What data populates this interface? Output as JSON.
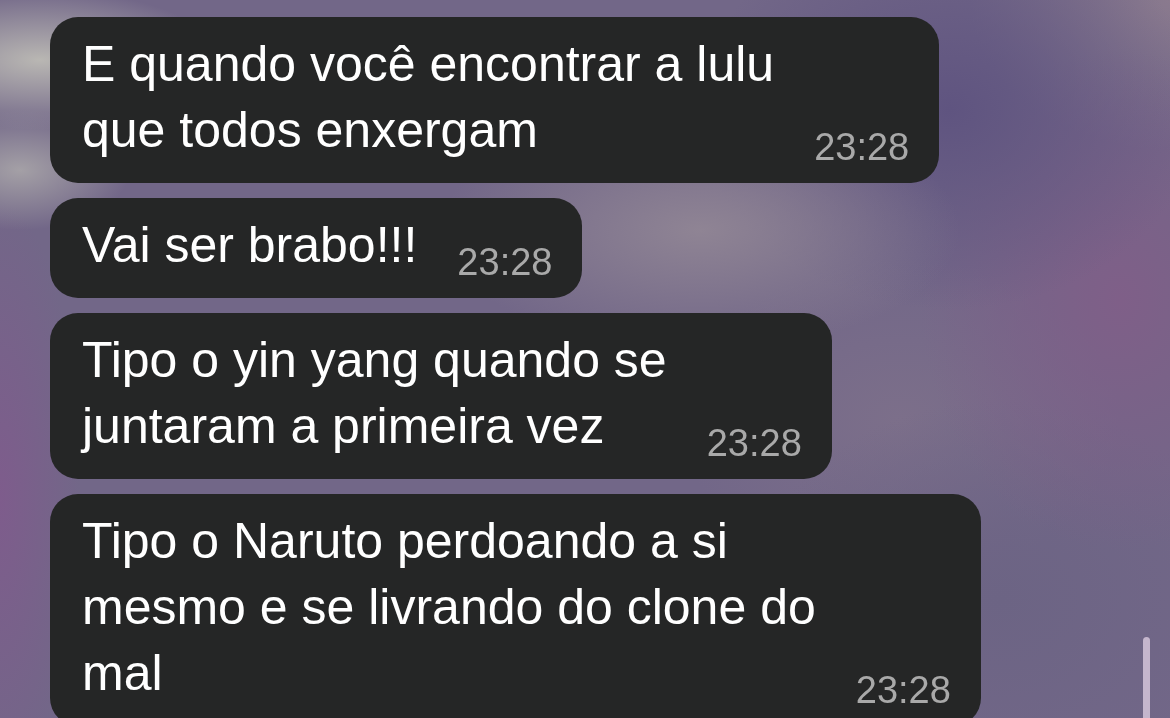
{
  "messages": [
    {
      "text": "E quando você encontrar a lulu\nque todos enxergam",
      "time": "23:28"
    },
    {
      "text": "Vai ser brabo!!!",
      "time": "23:28"
    },
    {
      "text": "Tipo o yin yang quando se\njuntaram a primeira vez",
      "time": "23:28"
    },
    {
      "text": "Tipo o Naruto perdoando a si\nmesmo e se livrando do clone do\nmal",
      "time": "23:28"
    }
  ]
}
